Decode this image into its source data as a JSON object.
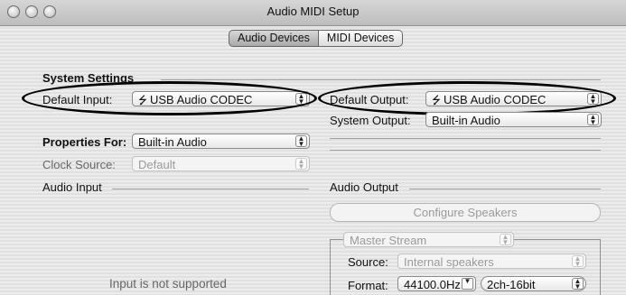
{
  "window": {
    "title": "Audio MIDI Setup"
  },
  "tabs": [
    {
      "label": "Audio Devices",
      "active": true
    },
    {
      "label": "MIDI Devices",
      "active": false
    }
  ],
  "system_settings": {
    "heading": "System Settings",
    "default_input_label": "Default Input:",
    "default_input_value": "USB Audio CODEC",
    "default_output_label": "Default Output:",
    "default_output_value": "USB Audio CODEC",
    "system_output_label": "System Output:",
    "system_output_value": "Built-in Audio"
  },
  "properties": {
    "label": "Properties For:",
    "value": "Built-in Audio",
    "clock_source_label": "Clock Source:",
    "clock_source_value": "Default"
  },
  "audio_input": {
    "heading": "Audio Input",
    "message": "Input is not supported"
  },
  "audio_output": {
    "heading": "Audio Output",
    "configure_button": "Configure Speakers",
    "stream": "Master Stream",
    "source_label": "Source:",
    "source_value": "Internal speakers",
    "format_label": "Format:",
    "format_rate": "44100.0Hz",
    "format_bits": "2ch-16bit"
  },
  "icons": {
    "usb": "usb-icon",
    "popup_arrows": "updown-arrows-icon"
  }
}
